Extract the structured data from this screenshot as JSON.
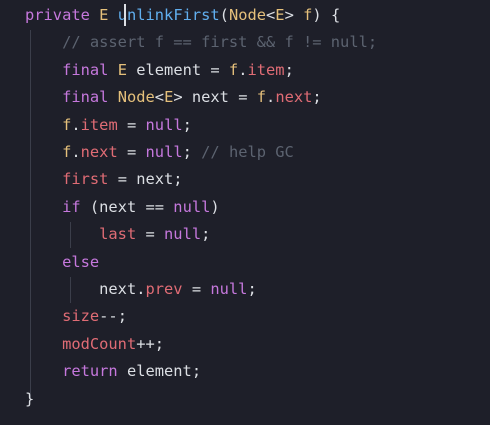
{
  "code": {
    "lines": [
      [
        {
          "t": "private",
          "c": "kw"
        },
        {
          "t": " ",
          "c": "plain"
        },
        {
          "t": "E",
          "c": "type"
        },
        {
          "t": " ",
          "c": "plain"
        },
        {
          "t": "unlinkFirst",
          "c": "fn"
        },
        {
          "t": "(",
          "c": "plain"
        },
        {
          "t": "Node",
          "c": "type"
        },
        {
          "t": "<",
          "c": "plain"
        },
        {
          "t": "E",
          "c": "type"
        },
        {
          "t": "> ",
          "c": "plain"
        },
        {
          "t": "f",
          "c": "type"
        },
        {
          "t": ") {",
          "c": "plain"
        }
      ],
      [
        {
          "t": "    ",
          "c": "plain"
        },
        {
          "t": "// assert f == first && f != null;",
          "c": "comment"
        }
      ],
      [
        {
          "t": "    ",
          "c": "plain"
        },
        {
          "t": "final",
          "c": "kw"
        },
        {
          "t": " ",
          "c": "plain"
        },
        {
          "t": "E",
          "c": "type"
        },
        {
          "t": " element = ",
          "c": "plain"
        },
        {
          "t": "f",
          "c": "type"
        },
        {
          "t": ".",
          "c": "plain"
        },
        {
          "t": "item",
          "c": "field"
        },
        {
          "t": ";",
          "c": "plain"
        }
      ],
      [
        {
          "t": "    ",
          "c": "plain"
        },
        {
          "t": "final",
          "c": "kw"
        },
        {
          "t": " ",
          "c": "plain"
        },
        {
          "t": "Node",
          "c": "type"
        },
        {
          "t": "<",
          "c": "plain"
        },
        {
          "t": "E",
          "c": "type"
        },
        {
          "t": "> next = ",
          "c": "plain"
        },
        {
          "t": "f",
          "c": "type"
        },
        {
          "t": ".",
          "c": "plain"
        },
        {
          "t": "next",
          "c": "field"
        },
        {
          "t": ";",
          "c": "plain"
        }
      ],
      [
        {
          "t": "    ",
          "c": "plain"
        },
        {
          "t": "f",
          "c": "type"
        },
        {
          "t": ".",
          "c": "plain"
        },
        {
          "t": "item",
          "c": "field"
        },
        {
          "t": " = ",
          "c": "plain"
        },
        {
          "t": "null",
          "c": "kw"
        },
        {
          "t": ";",
          "c": "plain"
        }
      ],
      [
        {
          "t": "    ",
          "c": "plain"
        },
        {
          "t": "f",
          "c": "type"
        },
        {
          "t": ".",
          "c": "plain"
        },
        {
          "t": "next",
          "c": "field"
        },
        {
          "t": " = ",
          "c": "plain"
        },
        {
          "t": "null",
          "c": "kw"
        },
        {
          "t": "; ",
          "c": "plain"
        },
        {
          "t": "// help GC",
          "c": "comment"
        }
      ],
      [
        {
          "t": "    ",
          "c": "plain"
        },
        {
          "t": "first",
          "c": "field"
        },
        {
          "t": " = next;",
          "c": "plain"
        }
      ],
      [
        {
          "t": "    ",
          "c": "plain"
        },
        {
          "t": "if",
          "c": "kw"
        },
        {
          "t": " (next == ",
          "c": "plain"
        },
        {
          "t": "null",
          "c": "kw"
        },
        {
          "t": ")",
          "c": "plain"
        }
      ],
      [
        {
          "t": "        ",
          "c": "plain"
        },
        {
          "t": "last",
          "c": "field"
        },
        {
          "t": " = ",
          "c": "plain"
        },
        {
          "t": "null",
          "c": "kw"
        },
        {
          "t": ";",
          "c": "plain"
        }
      ],
      [
        {
          "t": "    ",
          "c": "plain"
        },
        {
          "t": "else",
          "c": "kw"
        }
      ],
      [
        {
          "t": "        ",
          "c": "plain"
        },
        {
          "t": "next.",
          "c": "plain"
        },
        {
          "t": "prev",
          "c": "field"
        },
        {
          "t": " = ",
          "c": "plain"
        },
        {
          "t": "null",
          "c": "kw"
        },
        {
          "t": ";",
          "c": "plain"
        }
      ],
      [
        {
          "t": "    ",
          "c": "plain"
        },
        {
          "t": "size",
          "c": "field"
        },
        {
          "t": "--;",
          "c": "plain"
        }
      ],
      [
        {
          "t": "    ",
          "c": "plain"
        },
        {
          "t": "modCount",
          "c": "field"
        },
        {
          "t": "++;",
          "c": "plain"
        }
      ],
      [
        {
          "t": "    ",
          "c": "plain"
        },
        {
          "t": "return",
          "c": "kw"
        },
        {
          "t": " element;",
          "c": "plain"
        }
      ],
      [
        {
          "t": "}",
          "c": "plain"
        }
      ]
    ]
  },
  "colors": {
    "background": "#1e1f29",
    "keyword": "#c678dd",
    "type": "#e5c07b",
    "function": "#61afef",
    "field": "#e06c75",
    "text": "#dcdfe4",
    "comment": "#5c6370",
    "indent_guide": "#3b3e4a"
  }
}
